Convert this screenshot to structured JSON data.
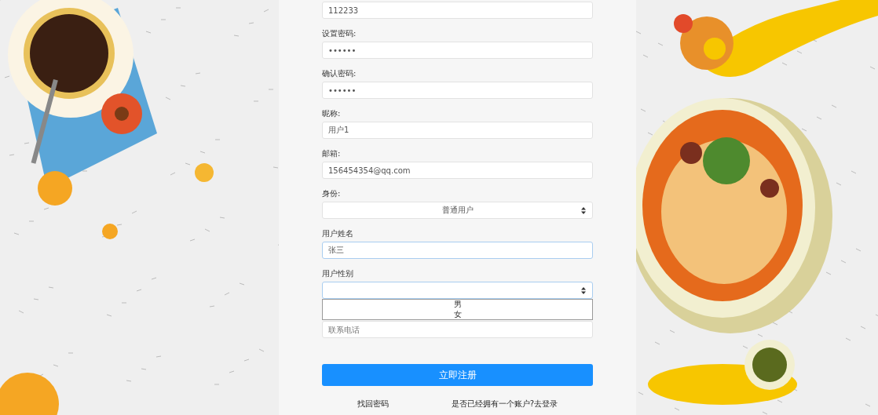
{
  "form": {
    "fields": [
      {
        "kind": "input",
        "value": "112233",
        "focused": false
      },
      {
        "kind": "input",
        "label": "设置密码:",
        "value": "••••••",
        "focused": false
      },
      {
        "kind": "input",
        "label": "确认密码:",
        "value": "••••••",
        "focused": false
      },
      {
        "kind": "input",
        "label": "昵称:",
        "value": "用户1",
        "focused": false
      },
      {
        "kind": "input",
        "label": "邮箱:",
        "value": "156454354@qq.com",
        "focused": false
      },
      {
        "kind": "select",
        "label": "身份:",
        "value": "普通用户",
        "expanded": false,
        "focused": false
      },
      {
        "kind": "input",
        "label": "用户姓名",
        "value": "张三",
        "focused": true
      },
      {
        "kind": "select",
        "label": "用户性别",
        "expanded": true,
        "focused": true,
        "options": [
          "男",
          "女"
        ]
      },
      {
        "kind": "input",
        "placeholder": "联系电话",
        "focused": false
      }
    ],
    "submit": "立即注册",
    "links": [
      "找回密码",
      "是否已经拥有一个账户?去登录"
    ]
  }
}
